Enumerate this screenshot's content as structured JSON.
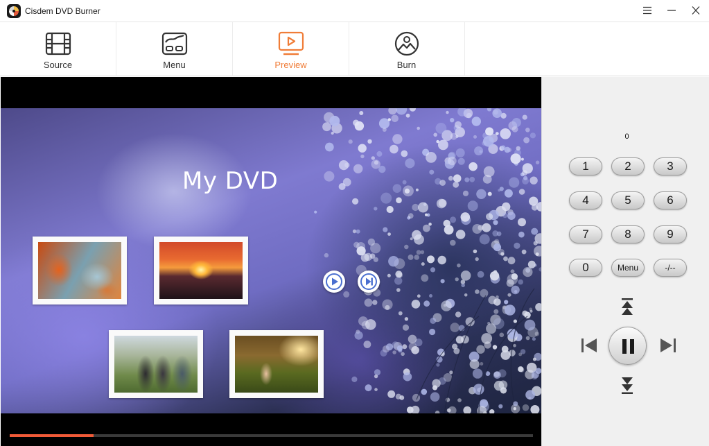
{
  "window": {
    "title": "Cisdem DVD Burner"
  },
  "tabs": [
    {
      "label": "Source",
      "icon": "film-icon"
    },
    {
      "label": "Menu",
      "icon": "menu-layout-icon"
    },
    {
      "label": "Preview",
      "icon": "preview-play-icon"
    },
    {
      "label": "Burn",
      "icon": "disc-image-icon"
    }
  ],
  "active_tab": "Preview",
  "accent_color": "#f07d38",
  "preview": {
    "dvd_title": "My DVD",
    "progress_fraction": 0.16,
    "progress_color": "#f05a37"
  },
  "remote": {
    "readout": "0",
    "keys": [
      "1",
      "2",
      "3",
      "4",
      "5",
      "6",
      "7",
      "8",
      "9",
      "0",
      "Menu",
      "-/--"
    ]
  }
}
